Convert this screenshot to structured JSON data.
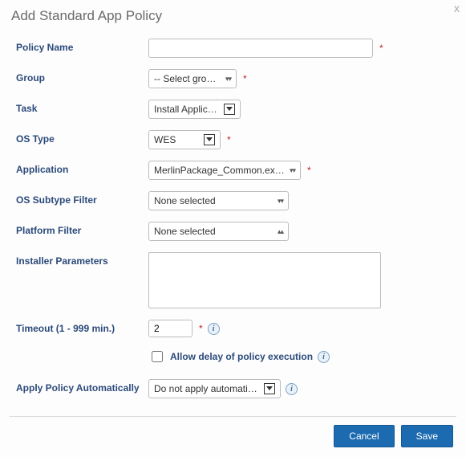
{
  "dialog": {
    "title": "Add Standard App Policy",
    "close_glyph": "x"
  },
  "labels": {
    "policy_name": "Policy Name",
    "group": "Group",
    "task": "Task",
    "os_type": "OS Type",
    "application": "Application",
    "os_subtype_filter": "OS Subtype Filter",
    "platform_filter": "Platform Filter",
    "installer_parameters": "Installer Parameters",
    "timeout": "Timeout (1 - 999 min.)",
    "allow_delay": "Allow delay of policy execution",
    "apply_auto": "Apply Policy Automatically"
  },
  "values": {
    "policy_name": "",
    "group": "-- Select group --",
    "task": "Install Application",
    "os_type": "WES",
    "application": "MerlinPackage_Common.exe (Loc",
    "os_subtype_filter": "None selected",
    "platform_filter": "None selected",
    "installer_parameters": "",
    "timeout": "2",
    "allow_delay_checked": false,
    "apply_auto": "Do not apply automatically"
  },
  "required_marker": "*",
  "info_glyph": "i",
  "footer": {
    "cancel": "Cancel",
    "save": "Save"
  }
}
